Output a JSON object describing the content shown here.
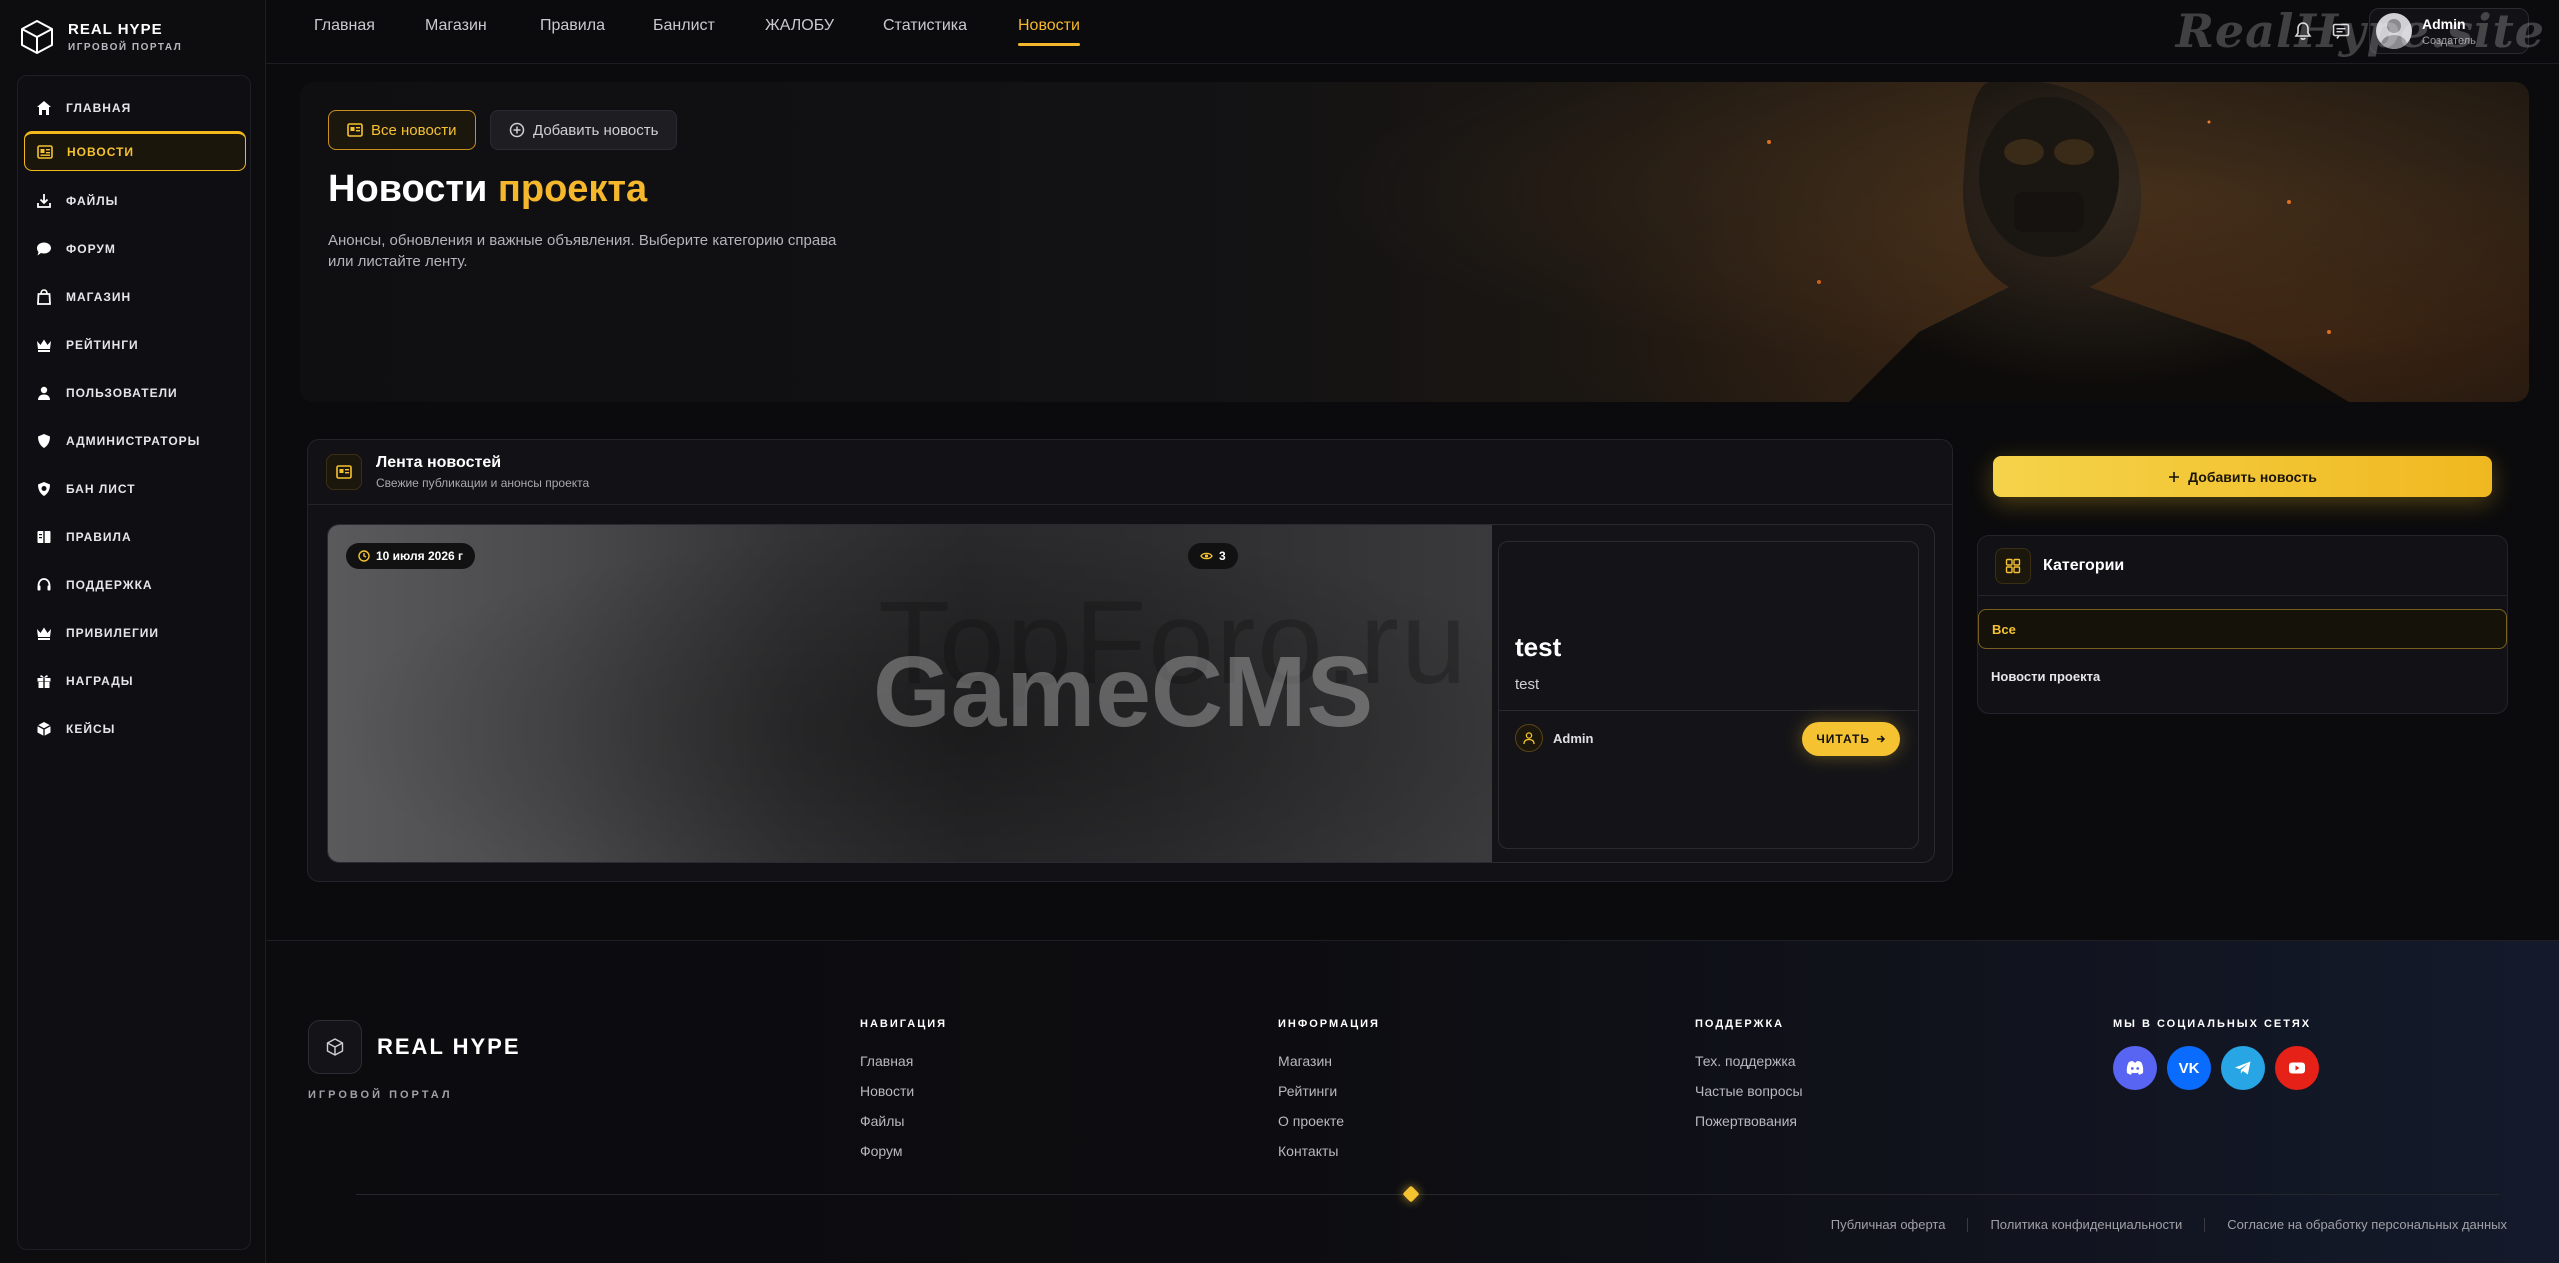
{
  "brand": {
    "name": "REAL HYPE",
    "subtitle": "ИГРОВОЙ ПОРТАЛ"
  },
  "sidebar": {
    "items": [
      {
        "label": "ГЛАВНАЯ",
        "icon": "home-icon"
      },
      {
        "label": "НОВОСТИ",
        "icon": "news-icon",
        "active": true
      },
      {
        "label": "ФАЙЛЫ",
        "icon": "download-icon"
      },
      {
        "label": "ФОРУМ",
        "icon": "chat-icon"
      },
      {
        "label": "МАГАЗИН",
        "icon": "bag-icon"
      },
      {
        "label": "РЕЙТИНГИ",
        "icon": "crown-icon"
      },
      {
        "label": "ПОЛЬЗОВАТЕЛИ",
        "icon": "users-icon"
      },
      {
        "label": "АДМИНИСТРАТОРЫ",
        "icon": "shield-icon"
      },
      {
        "label": "БАН ЛИСТ",
        "icon": "ban-shield-icon"
      },
      {
        "label": "ПРАВИЛА",
        "icon": "book-icon"
      },
      {
        "label": "ПОДДЕРЖКА",
        "icon": "headset-icon"
      },
      {
        "label": "ПРИВИЛЕГИИ",
        "icon": "crown-icon"
      },
      {
        "label": "НАГРАДЫ",
        "icon": "gift-icon"
      },
      {
        "label": "КЕЙСЫ",
        "icon": "cube-icon"
      }
    ]
  },
  "topnav": {
    "links": [
      "Главная",
      "Магазин",
      "Правила",
      "Банлист",
      "ЖАЛОБУ",
      "Статистика",
      "Новости"
    ],
    "active": "Новости"
  },
  "user": {
    "name": "Admin",
    "role": "Создатель"
  },
  "watermark_top": "RealHype.site",
  "hero": {
    "btn_all": "Все новости",
    "btn_add": "Добавить новость",
    "title_main": "Новости",
    "title_accent": "проекта",
    "description": "Анонсы, обновления и важные объявления. Выберите категорию справа или листайте ленту."
  },
  "feed": {
    "title": "Лента новостей",
    "subtitle": "Свежие публикации и анонсы проекта",
    "cards": [
      {
        "date": "10 июля 2026 г",
        "views": "3",
        "title": "test",
        "text": "test",
        "author": "Admin",
        "read_label": "ЧИТАТЬ",
        "image_watermark_1": "TopForo.ru",
        "image_watermark_2": "GameCMS"
      }
    ]
  },
  "aside": {
    "add_button": "Добавить новость",
    "categories_title": "Категории",
    "categories": [
      {
        "label": "Все",
        "active": true
      },
      {
        "label": "Новости проекта",
        "active": false
      }
    ]
  },
  "footer": {
    "brand": "REAL HYPE",
    "subtitle": "ИГРОВОЙ ПОРТАЛ",
    "columns": [
      {
        "heading": "НАВИГАЦИЯ",
        "links": [
          "Главная",
          "Новости",
          "Файлы",
          "Форум"
        ]
      },
      {
        "heading": "ИНФОРМАЦИЯ",
        "links": [
          "Магазин",
          "Рейтинги",
          "О проекте",
          "Контакты"
        ]
      },
      {
        "heading": "ПОДДЕРЖКА",
        "links": [
          "Тех. поддержка",
          "Частые вопросы",
          "Пожертвования"
        ]
      }
    ],
    "social_heading": "МЫ В СОЦИАЛЬНЫХ СЕТЯХ",
    "socials": [
      {
        "name": "discord-icon",
        "color": "#5865f2"
      },
      {
        "name": "vk-icon",
        "color": "#0a6cff"
      },
      {
        "name": "telegram-icon",
        "color": "#27a5e5"
      },
      {
        "name": "youtube-icon",
        "color": "#e62117"
      }
    ],
    "legal": [
      "Публичная оферта",
      "Политика конфиденциальности",
      "Согласие на обработку персональных данных"
    ]
  },
  "colors": {
    "accent": "#f5b82c",
    "bg": "#0b0b0d",
    "panel": "#121216"
  }
}
